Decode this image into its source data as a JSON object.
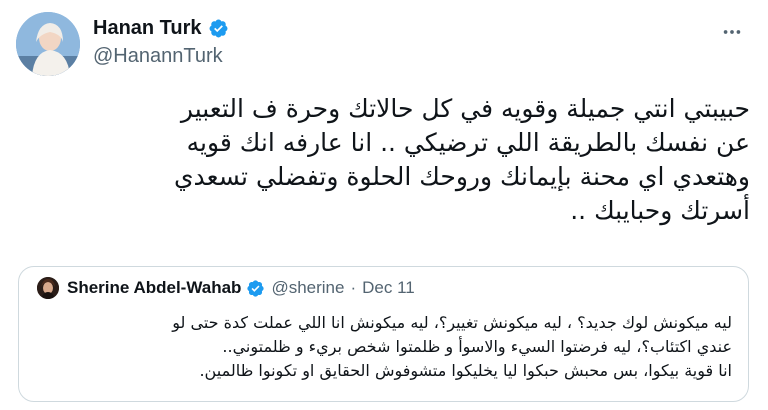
{
  "tweet": {
    "author": {
      "display_name": "Hanan Turk",
      "handle": "@HanannTurk",
      "verified": true
    },
    "text": "حبيبتي انتي جميلة وقويه  في كل حالاتك وحرة ف التعبير\nعن نفسك بالطريقة اللي ترضيكي  .. انا عارفه انك  قويه\nوهتعدي اي محنة بإيمانك وروحك الحلوة وتفضلي تسعدي\nأسرتك وحبايبك ..",
    "more_icon": "more-horizontal-icon"
  },
  "quoted_tweet": {
    "author": {
      "display_name": "Sherine Abdel-Wahab",
      "handle": "@sherine",
      "verified": true
    },
    "separator": "·",
    "date": "Dec 11",
    "text": "ليه ميكونش لوك جديد؟ ، ليه ميكونش تغيير؟، ليه ميكونش انا اللي عملت كدة حتى لو\nعندي اكتئاب؟، ليه فرضتوا السيء والاسوأ و ظلمتوا شخص بريء و ظلمتوني..\nانا قوية بيكوا، بس محبش حبكوا ليا يخليكوا متشوفوش الحقايق او تكونوا ظالمين."
  },
  "colors": {
    "verified_blue": "#1d9bf0",
    "text_primary": "#0f1419",
    "text_secondary": "#536471",
    "border": "#cfd9de"
  }
}
